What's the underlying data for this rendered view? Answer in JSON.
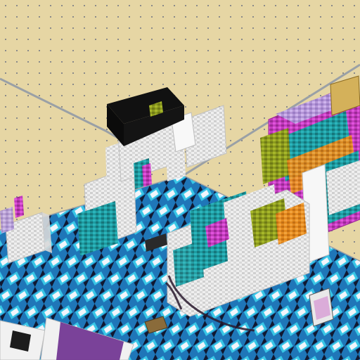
{
  "scene": {
    "kind": "isometric-room",
    "colors": {
      "wall": "#e6d6a4",
      "wall_stud": "#8a8a8a",
      "wall_trim": "#9aa0a6",
      "floor_dark": "#101830",
      "floor_mid": "#1f76b8",
      "floor_light": "#38c6e6",
      "floor_white": "#f1f5fb",
      "accent_magenta": "#c23bbd",
      "accent_teal": "#1e9aa0",
      "accent_olive": "#8c9a1e",
      "accent_orange": "#e48a1f",
      "accent_lavender": "#b39ad8",
      "black_panel": "#111111"
    }
  }
}
